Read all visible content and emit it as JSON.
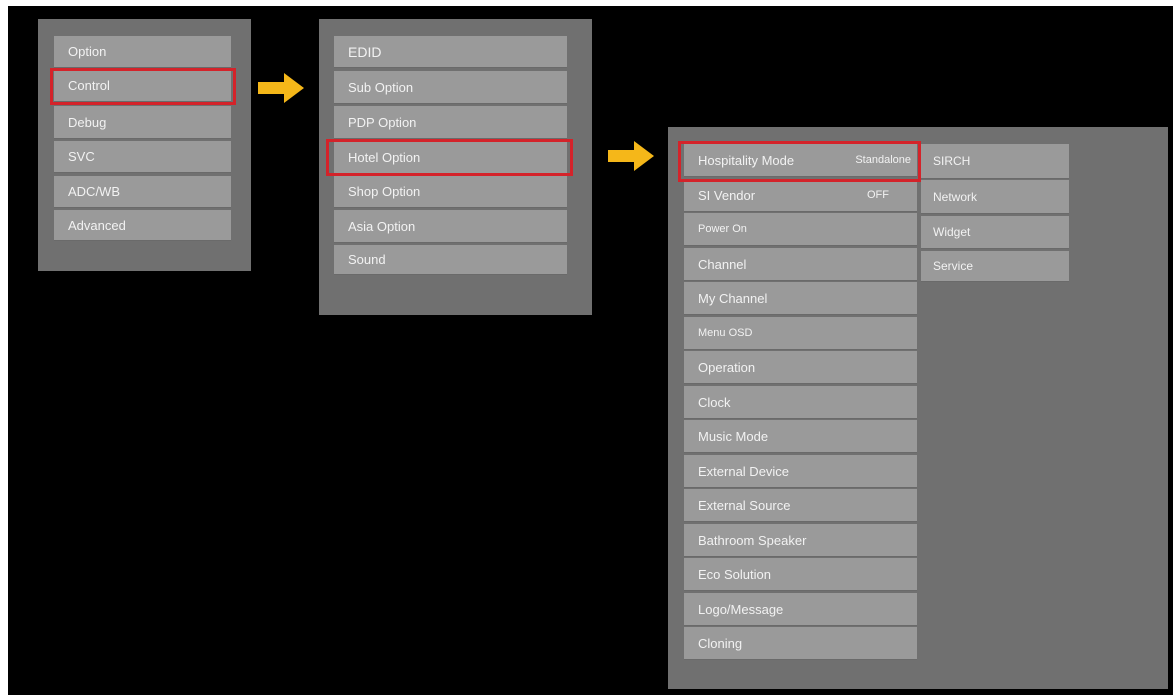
{
  "menu1": {
    "items": [
      "Option",
      "Control",
      "Debug",
      "SVC",
      "ADC/WB",
      "Advanced"
    ],
    "selected": "Control"
  },
  "menu2": {
    "items": [
      "EDID",
      "Sub Option",
      "PDP Option",
      "Hotel Option",
      "Shop Option",
      "Asia Option",
      "Sound"
    ],
    "selected": "Hotel Option"
  },
  "menu3": {
    "items": [
      {
        "label": "Hospitality Mode",
        "value": "Standalone"
      },
      {
        "label": "SI Vendor",
        "value": "OFF"
      },
      {
        "label": "Power On",
        "value": ""
      },
      {
        "label": "Channel",
        "value": ""
      },
      {
        "label": "My Channel",
        "value": ""
      },
      {
        "label": "Menu OSD",
        "value": ""
      },
      {
        "label": "Operation",
        "value": ""
      },
      {
        "label": "Clock",
        "value": ""
      },
      {
        "label": "Music Mode",
        "value": ""
      },
      {
        "label": "External Device",
        "value": ""
      },
      {
        "label": "External Source",
        "value": ""
      },
      {
        "label": "Bathroom Speaker",
        "value": ""
      },
      {
        "label": "Eco Solution",
        "value": ""
      },
      {
        "label": "Logo/Message",
        "value": ""
      },
      {
        "label": "Cloning",
        "value": ""
      }
    ],
    "selected": "Hospitality Mode"
  },
  "menu4": {
    "items": [
      "SIRCH",
      "Network",
      "Widget",
      "Service"
    ]
  },
  "colors": {
    "highlight": "#d4232a",
    "arrow": "#f5b719",
    "panel": "#707070",
    "item": "#9a9a9a"
  },
  "icons": [
    "arrow-right-icon",
    "arrow-right-icon"
  ]
}
